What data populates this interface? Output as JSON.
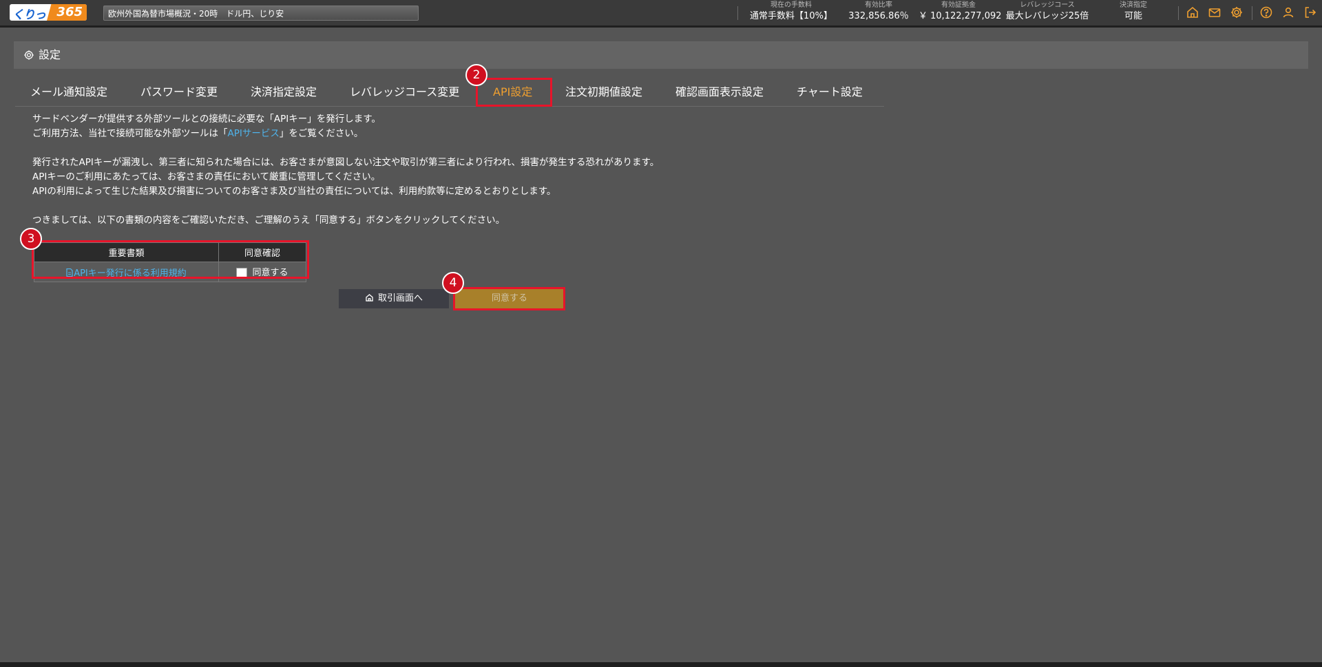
{
  "header": {
    "logo_text": "くりっく",
    "logo_number": "365",
    "ticker": "欧州外国為替市場概況・20時　ドル円、じり安",
    "stats": [
      {
        "label": "現在の手数料",
        "value": "通常手数料【10%】"
      },
      {
        "label": "有効比率",
        "value": "332,856.86％"
      },
      {
        "label": "有効証拠金",
        "value": "￥ 10,122,277,092"
      },
      {
        "label": "レバレッジコース",
        "value": "最大レバレッジ25倍"
      },
      {
        "label": "決済指定",
        "value": "可能"
      }
    ],
    "icons": [
      "home-icon",
      "mail-icon",
      "gear-icon",
      "help-icon",
      "user-icon",
      "logout-icon"
    ],
    "icon_color": "#f0a030"
  },
  "settings": {
    "title": "設定"
  },
  "tabs": [
    {
      "label": "メール通知設定"
    },
    {
      "label": "パスワード変更"
    },
    {
      "label": "決済指定設定"
    },
    {
      "label": "レバレッジコース変更"
    },
    {
      "label": "API設定",
      "active": true
    },
    {
      "label": "注文初期値設定"
    },
    {
      "label": "確認画面表示設定"
    },
    {
      "label": "チャート設定"
    }
  ],
  "content": {
    "line1": "サードベンダーが提供する外部ツールとの接続に必要な「APIキー」を発行します。",
    "line2_pre": "ご利用方法、当社で接続可能な外部ツールは「",
    "line2_link": "APIサービス",
    "line2_post": "」をご覧ください。",
    "line3": "発行されたAPIキーが漏洩し、第三者に知られた場合には、お客さまが意図しない注文や取引が第三者により行われ、損害が発生する恐れがあります。",
    "line4": "APIキーのご利用にあたっては、お客さまの責任において厳重に管理してください。",
    "line5": "APIの利用によって生じた結果及び損害についてのお客さま及び当社の責任については、利用約款等に定めるとおりとします。",
    "line6": "つきましては、以下の書類の内容をご確認いただき、ご理解のうえ「同意する」ボタンをクリックしてください。"
  },
  "agreement_table": {
    "col_document": "重要書類",
    "col_consent": "同意確認",
    "document_link": "APIキー発行に係る利用規約",
    "checkbox_label": "同意する",
    "checked": false
  },
  "buttons": {
    "home": "取引画面へ",
    "agree": "同意する"
  },
  "annotations": {
    "badge_tab": "2",
    "badge_table": "3",
    "badge_button": "4"
  },
  "colors": {
    "background": "#555555",
    "active_tab": "#f0a030",
    "link": "#4fb3ea",
    "highlight": "#e8142a",
    "agree_button": "#a8802a"
  }
}
